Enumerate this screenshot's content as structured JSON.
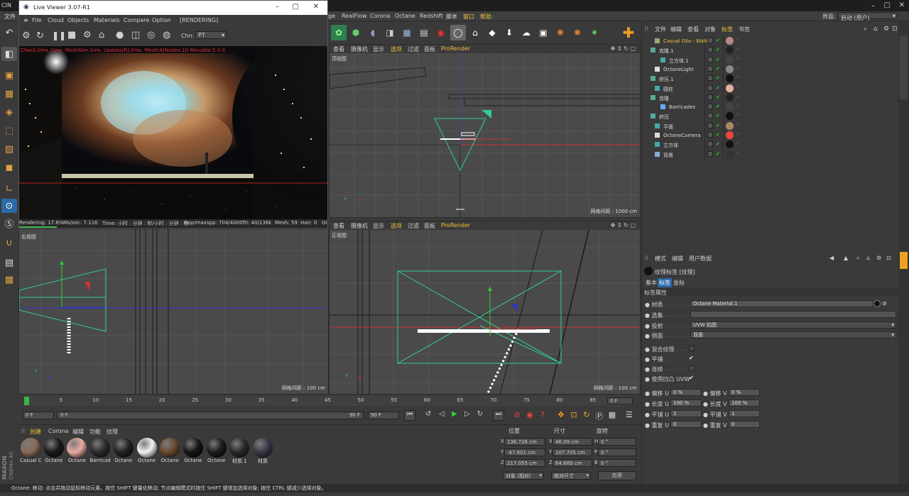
{
  "app": {
    "title_fragment": "CIN",
    "menus_left": [
      "文件"
    ],
    "menus_right": [
      "ge",
      "RealFlow",
      "Corona",
      "Octane",
      "Redshift",
      "脚本",
      "窗口",
      "帮助"
    ],
    "layout_label": "界面:",
    "layout_value": "启动 (用户)"
  },
  "live_viewer": {
    "title": "Live Viewer 3.07-R1",
    "menu": [
      "File",
      "Cloud",
      "Objects",
      "Materials",
      "Compare",
      "Option",
      "[RENDERING]"
    ],
    "channel_label": "Chn:",
    "channel_value": "PT",
    "overlay_text": "Check:0ms./1ms. MeshGen:1ms. Update[R]:0ms. Mesh(4)Nodes:10 Movable:5 0 0",
    "status": {
      "rendering": "Rendering: 17.6%",
      "ms_sec": "Ms/sec: 7.116",
      "time": "Time: 小时 : 分钟 : 秒/小时 : 分钟 : 秒",
      "spp": "Spp/maxspp: 704/4000",
      "tri": "Tri: 40/136k",
      "mesh": "Mesh: 59",
      "hair": "Hair: 0",
      "gpu": "GI"
    },
    "progress": 0.176
  },
  "viewports": {
    "menu": [
      "查看",
      "摄像机",
      "显示",
      "选项",
      "过滤",
      "面板",
      "ProRender"
    ],
    "top": {
      "name": "顶视图",
      "grid": "网格间距 : 1000 cm"
    },
    "right": {
      "name": "右视图",
      "grid": "网格间距 : 100 cm"
    },
    "front": {
      "name": "正视图",
      "grid": "网格间距 : 100 cm"
    }
  },
  "object_manager": {
    "menu": [
      "文件",
      "编辑",
      "查看",
      "对象",
      "标签",
      "书签"
    ],
    "objects": [
      {
        "name": "Casual 03a - Walk",
        "highlight": true
      },
      {
        "name": "克隆.1",
        "highlight": false
      },
      {
        "name": "立方体.1",
        "highlight": false
      },
      {
        "name": "OctaneLight",
        "highlight": false
      },
      {
        "name": "挤压.1",
        "highlight": false
      },
      {
        "name": "圆柱",
        "highlight": false
      },
      {
        "name": "克隆",
        "highlight": false
      },
      {
        "name": "Barricades",
        "highlight": false
      },
      {
        "name": "挤压",
        "highlight": false
      },
      {
        "name": "平面",
        "highlight": false
      },
      {
        "name": "OctaneCamera",
        "highlight": false
      },
      {
        "name": "立方体",
        "highlight": false
      },
      {
        "name": "背景",
        "highlight": false
      }
    ]
  },
  "attribute_manager": {
    "menu": [
      "模式",
      "编辑",
      "用户数据"
    ],
    "header": "纹理标签 [纹理]",
    "tabs": [
      "基本",
      "标签",
      "坐标"
    ],
    "section": "标签属性",
    "material_label": "● 材质",
    "material_value": "Octane Material.1",
    "selection_label": "● 选集",
    "projection_label": "● 投射",
    "projection_value": "UVW 贴图",
    "side_label": "● 侧面",
    "side_value": "双面",
    "mix_label": "● 混合纹理",
    "tile_label": "● 平铺",
    "seamless_label": "● 连续",
    "use_uvw_label": "● 使用凹凸 UVW",
    "offset_u_label": "● 偏移 U",
    "offset_u": "0 %",
    "offset_v_label": "● 偏移 V",
    "offset_v": "0 %",
    "length_u_label": "● 长度 U",
    "length_u": "100 %",
    "length_v_label": "● 长度 V",
    "length_v": "100 %",
    "tiles_u_label": "● 平铺 U",
    "tiles_u": "1",
    "tiles_v_label": "● 平铺 V",
    "tiles_v": "1",
    "repeat_u_label": "● 重复 U",
    "repeat_u": "0",
    "repeat_v_label": "● 重复 V",
    "repeat_v": "0"
  },
  "timeline": {
    "ticks": [
      "0",
      "5",
      "10",
      "15",
      "20",
      "25",
      "30",
      "35",
      "40",
      "45",
      "50",
      "55",
      "60",
      "65",
      "70",
      "75",
      "80",
      "85",
      "90"
    ],
    "current_frame": "0 F",
    "start_frame": "0 F",
    "range_start": "0 F",
    "range_end": "90 F",
    "end_frame": "90 F",
    "frame_field": "0 F"
  },
  "material_manager": {
    "menu": [
      "创建",
      "Corona",
      "编辑",
      "功能",
      "纹理"
    ],
    "materials": [
      {
        "label": "Casual C",
        "color": "#8a6a58"
      },
      {
        "label": "Octane",
        "color": "#1a1a1a"
      },
      {
        "label": "Octane",
        "color": "#e8a9a0"
      },
      {
        "label": "Barricad",
        "color": "#2b2b2b"
      },
      {
        "label": "Octane",
        "color": "#222222"
      },
      {
        "label": "Octane",
        "color": "#f2f2f2"
      },
      {
        "label": "Octane",
        "color": "#6a4a30"
      },
      {
        "label": "Octane",
        "color": "#151515"
      },
      {
        "label": "Octane",
        "color": "#1c1c1c"
      },
      {
        "label": "材质.1",
        "color": "#2a2a2a"
      },
      {
        "label": "材质",
        "color": "#3a3a48"
      }
    ]
  },
  "coordinates": {
    "headers": [
      "位置",
      "尺寸",
      "旋转"
    ],
    "rows": [
      {
        "axis": "X",
        "pos": "136.726 cm",
        "size_axis": "X",
        "size": "46.09 cm",
        "rot_axis": "H",
        "rot": "0 °"
      },
      {
        "axis": "Y",
        "pos": "-47.601 cm",
        "size_axis": "Y",
        "size": "107.705 cm",
        "rot_axis": "P",
        "rot": "0 °"
      },
      {
        "axis": "Z",
        "pos": "217.055 cm",
        "size_axis": "Z",
        "size": "64.689 cm",
        "rot_axis": "B",
        "rot": "0 °"
      }
    ],
    "mode": "对象 (相对)",
    "size_mode": "绝对尺寸",
    "apply": "应用"
  },
  "status_bar": "Octane: 移动: 点击并拖动鼠标移动元素。按住 SHIFT 键量化移动; 节点编辑模式时按住 SHIFT 键增加选择对象; 按住 CTRL 键减少选择对象。",
  "brand": {
    "line1": "MAXON",
    "line2": "CINEMA 4D"
  },
  "colors": {
    "accent": "#f0a020",
    "selection": "#2a6aa8",
    "octane_green": "#3cb24a"
  }
}
